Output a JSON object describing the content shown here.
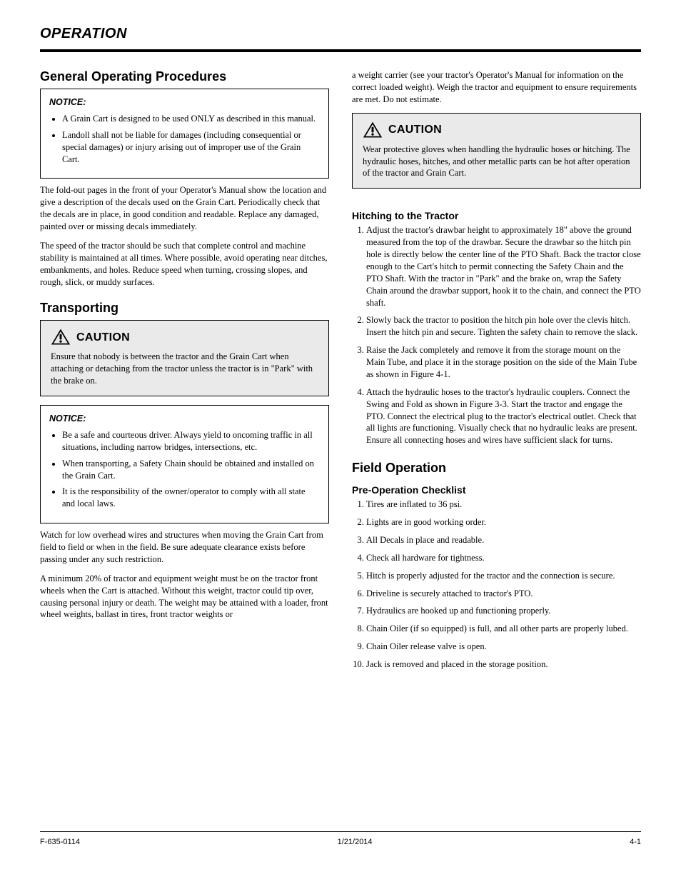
{
  "header": {
    "title": "OPERATION"
  },
  "left": {
    "general_heading": "General Operating Procedures",
    "notice1_title": "NOTICE:",
    "notice1_items": [
      "A Grain Cart is designed to be used ONLY as described in this manual.",
      "Landoll shall not be liable for damages (including consequential or special damages) or injury arising out of improper use of the Grain Cart."
    ],
    "p1": "The fold-out pages in the front of your Operator's Manual show the location and give a description of the decals used on the Grain Cart. Periodically check that the decals are in place, in good condition and readable. Replace any damaged, painted over or missing decals immediately.",
    "p2": "The speed of the tractor should be such that complete control and machine stability is maintained at all times. Where possible, avoid operating near ditches, embankments, and holes. Reduce speed when turning, crossing slopes, and rough, slick, or muddy surfaces.",
    "transporting_heading": "Transporting",
    "caution1_label": "CAUTION",
    "caution1_text": "Ensure that nobody is between the tractor and the Grain Cart when attaching or detaching from the tractor unless the tractor is in \"Park\" with the brake on.",
    "notice2_title": "NOTICE:",
    "notice2_items": [
      "Be a safe and courteous driver. Always yield to oncoming traffic in all situations, including narrow bridges, intersections, etc.",
      "When transporting, a Safety Chain should be obtained and installed on the Grain Cart.",
      "It is the responsibility of the owner/operator to comply with all state and local laws."
    ],
    "p3": "Watch for low overhead wires and structures when moving the Grain Cart from field to field or when in the field. Be sure adequate clearance exists before passing under any such restriction.",
    "p4": "A minimum 20% of tractor and equipment weight must be on the tractor front wheels when the Cart is attached. Without this weight, tractor could tip over, causing personal injury or death. The weight may be attained with a loader, front wheel weights, ballast in tires, front tractor weights or"
  },
  "right": {
    "p5": "a weight carrier (see your tractor's Operator's Manual for information on the correct loaded weight). Weigh the tractor and equipment to ensure requirements are met. Do not estimate.",
    "caution2_label": "CAUTION",
    "caution2_text": "Wear protective gloves when handling the hydraulic hoses or hitching. The hydraulic hoses, hitches, and other metallic parts can be hot after operation of the tractor and Grain Cart.",
    "hitching_heading": "Hitching to the Tractor",
    "hitch_step1": "Adjust the tractor's drawbar height to approximately 18\" above the ground measured from the top of the drawbar. Secure the drawbar so the hitch pin hole is directly below the center line of the PTO Shaft. Back the tractor close enough to the Cart's hitch to permit connecting the Safety Chain and the PTO Shaft. With the tractor in \"Park\" and the brake on, wrap the Safety Chain around the drawbar support, hook it to the chain, and connect the PTO shaft.",
    "hitch_step2": "Slowly back the tractor to position the hitch pin hole over the clevis hitch. Insert the hitch pin and secure. Tighten the safety chain to remove the slack.",
    "hitch_step3": "Raise the Jack completely and remove it from the storage mount on the Main Tube, and place it in the storage position on the side of the Main Tube as shown in Figure 4-1.",
    "hitch_step4": "Attach the hydraulic hoses to the tractor's hydraulic couplers. Connect the Swing and Fold as shown in Figure 3-3. Start the tractor and engage the PTO. Connect the electrical plug to the tractor's electrical outlet. Check that all lights are functioning. Visually check that no hydraulic leaks are present. Ensure all connecting hoses and wires have sufficient slack for turns.",
    "field_heading": "Field Operation",
    "sub_pre": "Pre-Operation Checklist",
    "pre_items": [
      "Tires are inflated to 36 psi.",
      "Lights are in good working order.",
      "All Decals in place and readable.",
      "Check all hardware for tightness.",
      "Hitch is properly adjusted for the tractor and the connection is secure.",
      "Driveline is securely attached to tractor's PTO.",
      "Hydraulics are hooked up and functioning properly.",
      "Chain Oiler (if so equipped) is full, and all other parts are properly lubed.",
      "Chain Oiler release valve is open.",
      "Jack is removed and placed in the storage position."
    ]
  },
  "footer": {
    "left": "F-635-0114",
    "center": "1/21/2014",
    "right": "4-1"
  }
}
